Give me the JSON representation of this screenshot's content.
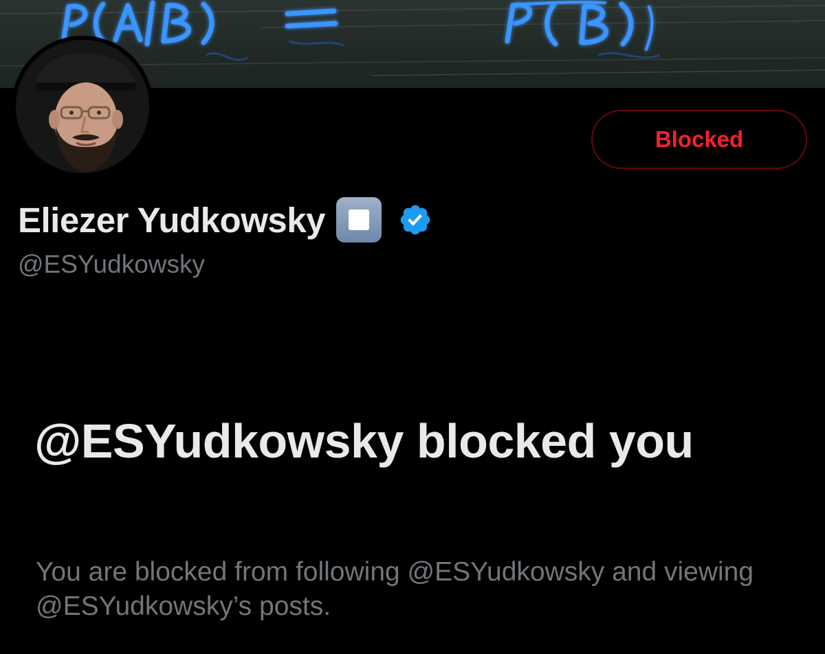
{
  "banner": {
    "neon_left_text": "P(A|B) =",
    "neon_right_text": "P(B)"
  },
  "profile": {
    "display_name": "Eliezer Yudkowsky",
    "name_emoji": "stop-button-emoji",
    "verified": true,
    "handle": "@ESYudkowsky"
  },
  "actions": {
    "blocked_label": "Blocked"
  },
  "block_notice": {
    "title": "@ESYudkowsky blocked you",
    "description": "You are blocked from following @ESYudkowsky and viewing @ESYudkowsky’s posts."
  },
  "colors": {
    "background": "#000000",
    "primary_text": "#e7e9ea",
    "secondary_text": "#71767b",
    "danger": "#f4212e",
    "verified_blue": "#1d9bf0",
    "neon_blue": "#2f8cff"
  }
}
